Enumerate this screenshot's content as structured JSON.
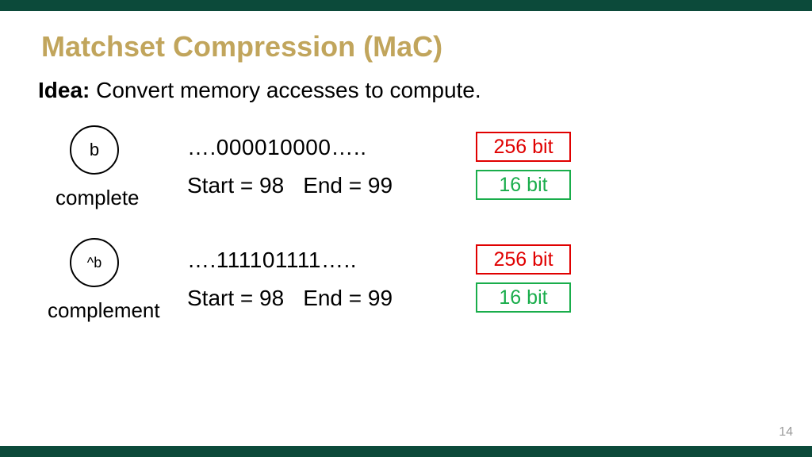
{
  "title": "Matchset Compression (MaC)",
  "idea_label": "Idea:",
  "idea_text": " Convert memory accesses to compute.",
  "examples": [
    {
      "symbol": "b",
      "label": "complete",
      "bits": "….000010000…..",
      "start_label": "Start = 98",
      "end_label": "End = 99",
      "size_orig": "256 bit",
      "size_comp": "16 bit"
    },
    {
      "symbol": "^b",
      "label": "complement",
      "bits": "….111101111…..",
      "start_label": "Start = 98",
      "end_label": "End = 99",
      "size_orig": "256 bit",
      "size_comp": "16 bit"
    }
  ],
  "page_number": "14"
}
